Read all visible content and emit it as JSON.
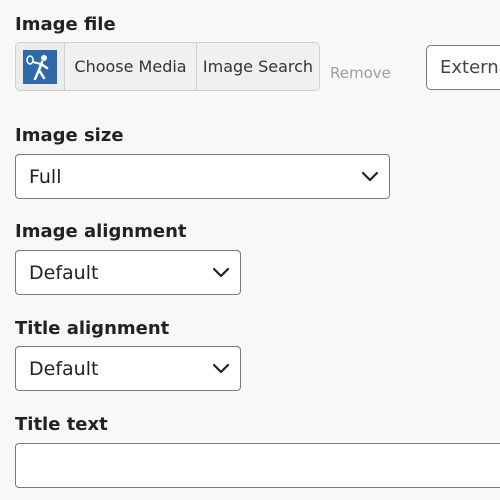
{
  "image_file": {
    "label": "Image file",
    "choose_media": "Choose Media",
    "image_search": "Image Search",
    "remove": "Remove",
    "external_placeholder": "External"
  },
  "image_size": {
    "label": "Image size",
    "value": "Full"
  },
  "image_alignment": {
    "label": "Image alignment",
    "value": "Default"
  },
  "title_alignment": {
    "label": "Title alignment",
    "value": "Default"
  },
  "title_text": {
    "label": "Title text",
    "value": ""
  },
  "colors": {
    "thumbnail_bg": "#2f69a8",
    "border": "#7a7a7a",
    "remove_text": "#9e9e9e"
  },
  "icons": {
    "thumbnail": "tennis-player-icon",
    "dropdown": "chevron-down-icon"
  }
}
